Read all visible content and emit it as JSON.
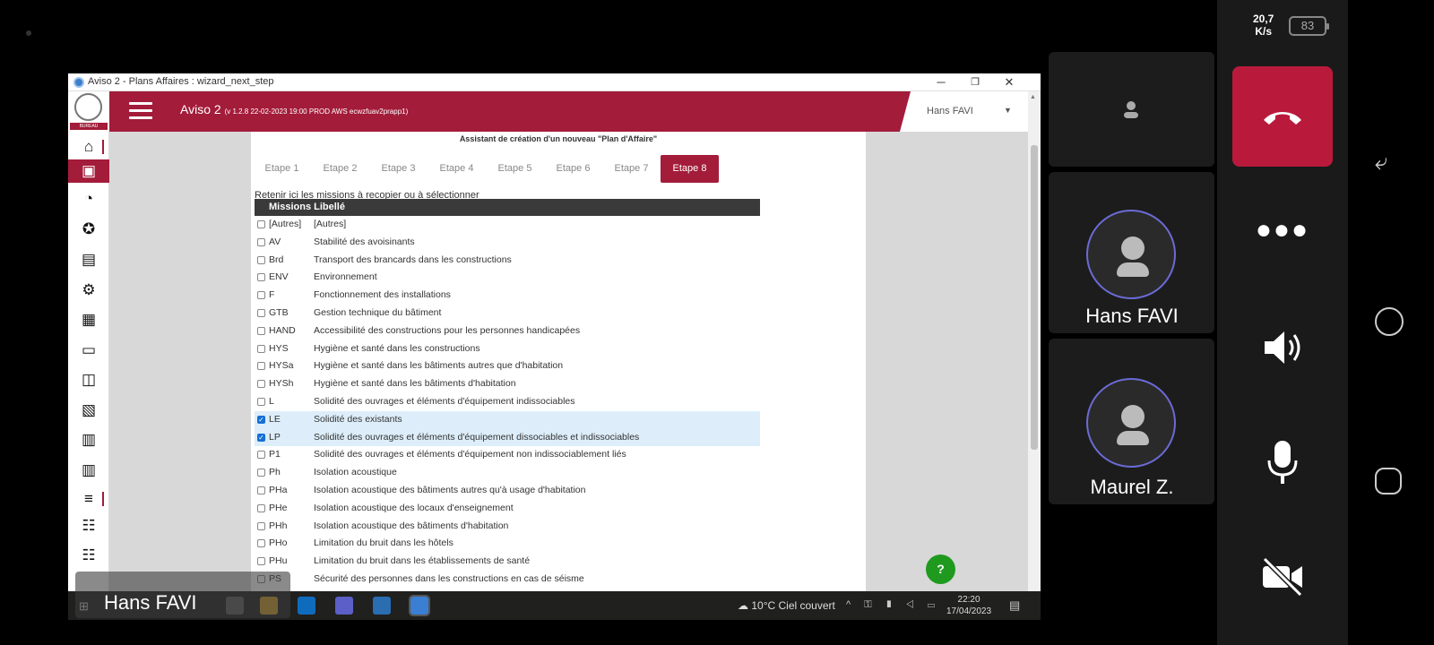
{
  "status": {
    "net_speed_line1": "20,7",
    "net_speed_line2": "K/s",
    "battery": "83"
  },
  "window": {
    "title": "Aviso 2 - Plans Affaires : wizard_next_step",
    "minimize": "─",
    "maximize": "❐",
    "close": "✕"
  },
  "app": {
    "name": "Aviso 2",
    "version": "(v 1.2.8 22-02-2023 19:00 PROD AWS ecwzfuav2prapp1)",
    "user": "Hans FAVI",
    "logo_text": "BUREAU VERITAS"
  },
  "wizard": {
    "heading": "Assistant de création d'un nouveau \"Plan d'Affaire\"",
    "steps": [
      "Etape 1",
      "Etape 2",
      "Etape 3",
      "Etape 4",
      "Etape 5",
      "Etape 6",
      "Etape 7",
      "Etape 8"
    ],
    "active_step": "Etape 8",
    "hint": "Retenir ici les missions à recopier ou à sélectionner",
    "columns": {
      "missions": "Missions",
      "libelle": "Libellé"
    },
    "rows": [
      {
        "code": "[Autres]",
        "label": "[Autres]",
        "checked": false
      },
      {
        "code": "AV",
        "label": "Stabilité des avoisinants",
        "checked": false
      },
      {
        "code": "Brd",
        "label": "Transport des brancards dans les constructions",
        "checked": false
      },
      {
        "code": "ENV",
        "label": "Environnement",
        "checked": false
      },
      {
        "code": "F",
        "label": "Fonctionnement des installations",
        "checked": false
      },
      {
        "code": "GTB",
        "label": "Gestion technique du bâtiment",
        "checked": false
      },
      {
        "code": "HAND",
        "label": "Accessibilité des constructions pour les personnes handicapées",
        "checked": false
      },
      {
        "code": "HYS",
        "label": "Hygiène et santé dans les constructions",
        "checked": false
      },
      {
        "code": "HYSa",
        "label": "Hygiène et santé dans les bâtiments autres que d'habitation",
        "checked": false
      },
      {
        "code": "HYSh",
        "label": "Hygiène et santé dans les bâtiments d'habitation",
        "checked": false
      },
      {
        "code": "L",
        "label": "Solidité des ouvrages et éléments d'équipement indissociables",
        "checked": false
      },
      {
        "code": "LE",
        "label": "Solidité des existants",
        "checked": true
      },
      {
        "code": "LP",
        "label": "Solidité des ouvrages et éléments d'équipement dissociables et indissociables",
        "checked": true
      },
      {
        "code": "P1",
        "label": "Solidité des ouvrages et éléments d'équipement non indissociablement liés",
        "checked": false
      },
      {
        "code": "Ph",
        "label": "Isolation acoustique",
        "checked": false
      },
      {
        "code": "PHa",
        "label": "Isolation acoustique des bâtiments autres qu'à usage d'habitation",
        "checked": false
      },
      {
        "code": "PHe",
        "label": "Isolation acoustique des locaux d'enseignement",
        "checked": false
      },
      {
        "code": "PHh",
        "label": "Isolation acoustique des bâtiments d'habitation",
        "checked": false
      },
      {
        "code": "PHo",
        "label": "Limitation du bruit dans les hôtels",
        "checked": false
      },
      {
        "code": "PHu",
        "label": "Limitation du bruit dans les établissements de santé",
        "checked": false
      },
      {
        "code": "PS",
        "label": "Sécurité des personnes dans les constructions en cas de séisme",
        "checked": false
      }
    ],
    "help": "?"
  },
  "taskbar": {
    "weather": "10°C  Ciel couvert",
    "time": "22:20",
    "date": "17/04/2023"
  },
  "call": {
    "presenter_overlay": "Hans FAVI",
    "participants": [
      "Hans FAVI",
      "Maurel Z."
    ]
  },
  "colors": {
    "brand": "#a31c3a",
    "hangup": "#b91a3b",
    "checkbox": "#1670d6",
    "help": "#1f9a1f"
  }
}
